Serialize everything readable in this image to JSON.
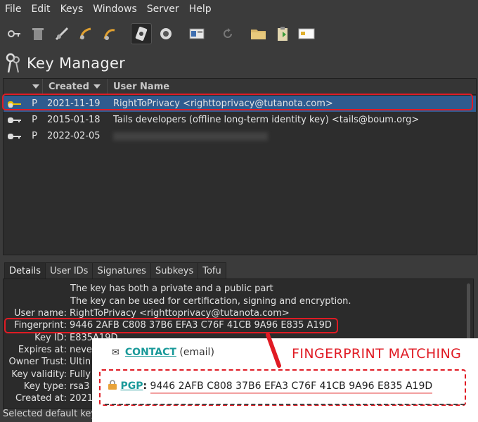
{
  "menu": [
    "File",
    "Edit",
    "Keys",
    "Windows",
    "Server",
    "Help"
  ],
  "toolbar": {
    "icons": [
      "key-search-icon",
      "delete-icon",
      "sign-icon",
      "import-icon",
      "export-icon",
      "keyserver-icon",
      "refresh-keys-icon",
      "card-icon",
      "reload-icon",
      "open-folder-icon",
      "clipboard-icon",
      "smartcard-icon"
    ]
  },
  "header": {
    "title": "Key Manager"
  },
  "key_list": {
    "columns": [
      "Created",
      "User Name"
    ],
    "rows": [
      {
        "type": "P",
        "created": "2021-11-19",
        "user_name": "RightToPrivacy <righttoprivacy@tutanota.com>",
        "selected": true
      },
      {
        "type": "P",
        "created": "2015-01-18",
        "user_name": "Tails developers (offline long-term identity key) <tails@boum.org>",
        "selected": false
      },
      {
        "type": "P",
        "created": "2022-02-05",
        "user_name": "",
        "selected": false
      }
    ]
  },
  "tabs": [
    "Details",
    "User IDs",
    "Signatures",
    "Subkeys",
    "Tofu"
  ],
  "details": {
    "note1": "The key has both a private and a public part",
    "note2": "The key can be used for certification, signing and encryption.",
    "fields": [
      {
        "label": "User name:",
        "value": "RightToPrivacy <righttoprivacy@tutanota.com>"
      },
      {
        "label": "Fingerprint:",
        "value": "9446 2AFB C808 37B6 EFA3  C76F 41CB 9A96 E835 A19D"
      },
      {
        "label": "Key ID:",
        "value": "E835A19D"
      },
      {
        "label": "Expires at:",
        "value": "neve"
      },
      {
        "label": "Owner Trust:",
        "value": "Ultin"
      },
      {
        "label": "Key validity:",
        "value": "Fully"
      },
      {
        "label": "Key type:",
        "value": "rsa3"
      },
      {
        "label": "Created at:",
        "value": "2021"
      }
    ]
  },
  "status": "Selected default key",
  "overlay": {
    "contact_link": "CONTACT",
    "contact_suffix": "(email)",
    "annotation": "FINGERPRINT MATCHING",
    "pgp_label": "PGP",
    "pgp_fingerprint": "9446 2AFB C808 37B6 EFA3  C76F 41CB 9A96 E835 A19D"
  },
  "colors": {
    "selection": "#2f5b8f",
    "highlight_red": "#e01b24",
    "link_teal": "#1a9a9a"
  }
}
